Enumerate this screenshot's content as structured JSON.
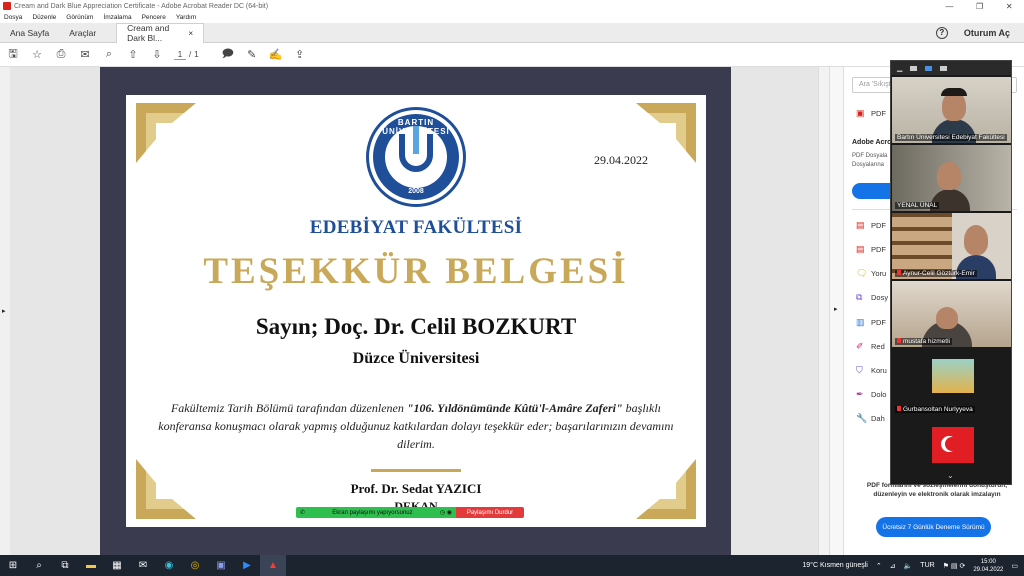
{
  "window": {
    "title": "Cream and Dark Blue Appreciation Certificate - Adobe Acrobat Reader DC (64-bit)",
    "controls": [
      "—",
      "❐",
      "✕"
    ]
  },
  "menu": [
    "Dosya",
    "Düzenle",
    "Görünüm",
    "İmzalama",
    "Pencere",
    "Yardım"
  ],
  "tabs": {
    "home": "Ana Sayfa",
    "tools": "Araçlar",
    "doc": "Cream and Dark Bl...",
    "doc_close": "×",
    "signin": "Oturum Aç",
    "help": "?"
  },
  "toolbar": {
    "page_current": "1",
    "page_sep": "/",
    "page_total": "1",
    "icons": [
      "save-icon",
      "bookmark-star-icon",
      "print-icon",
      "email-icon",
      "zoom-search-icon",
      "page-up-icon",
      "page-down-icon",
      "comment-icon",
      "pen-icon",
      "sign-icon",
      "share-icon"
    ]
  },
  "certificate": {
    "date": "29.04.2022",
    "seal_top": "BARTIN ÜNİVERSİTESİ",
    "seal_year": "2008",
    "faculty": "EDEBİYAT FAKÜLTESİ",
    "title": "TEŞEKKÜR BELGESİ",
    "recipient": "Sayın; Doç. Dr. Celil BOZKURT",
    "institution": "Düzce Üniversitesi",
    "body_pre": "Fakültemiz Tarih Bölümü tarafından düzenlenen ",
    "body_bold": "\"106. Yıldönümünde Kûtü'l-Amâre Zaferi\"",
    "body_post": " başlıklı konferansa konuşmacı olarak yapmış olduğunuz katkılardan dolayı teşekkür eder; başarılarınızın devamını dilerim.",
    "signer": "Prof. Dr. Sedat YAZICI",
    "role": "DEKAN",
    "gold": "#c9a85a",
    "navy": "#1f4f99"
  },
  "sharebar": {
    "sharing": "Ekran paylaşımı yapıyorsunuz",
    "stop": "Paylaşımı Durdur"
  },
  "right_panel": {
    "search_placeholder": "Ara 'Sıkıştır'",
    "items": [
      "PDF",
      "PDF",
      "PDF",
      "Yoru",
      "Dosy",
      "PDF",
      "Red",
      "Koru",
      "Dolo",
      "Dah"
    ],
    "acrobat_title": "Adobe Acro",
    "acrobat_desc_1": "PDF Dosyala",
    "acrobat_desc_2": "Dosyalarına",
    "promo": "PDF formlarını ve sözleşmelerini dönüştürün, düzenleyin ve elektronik olarak imzalayın",
    "trial": "Ücretsiz 7 Günlük Deneme Sürümü"
  },
  "participants": [
    {
      "name": "Bartın Üniversitesi Edebiyat Fakültesi",
      "muted": false
    },
    {
      "name": "YENAL ÜNAL",
      "muted": false
    },
    {
      "name": "Aynur-Celil Göztürk-Emir",
      "muted": true
    },
    {
      "name": "mustafa hizmetli",
      "muted": true
    },
    {
      "name": "Gurbansoltan Nurlyyeva",
      "muted": true
    },
    {
      "name": "",
      "muted": false
    }
  ],
  "taskbar": {
    "weather": "19°C  Kısmen güneşli",
    "lang": "TUR",
    "time": "15:00",
    "date": "29.04.2022"
  }
}
